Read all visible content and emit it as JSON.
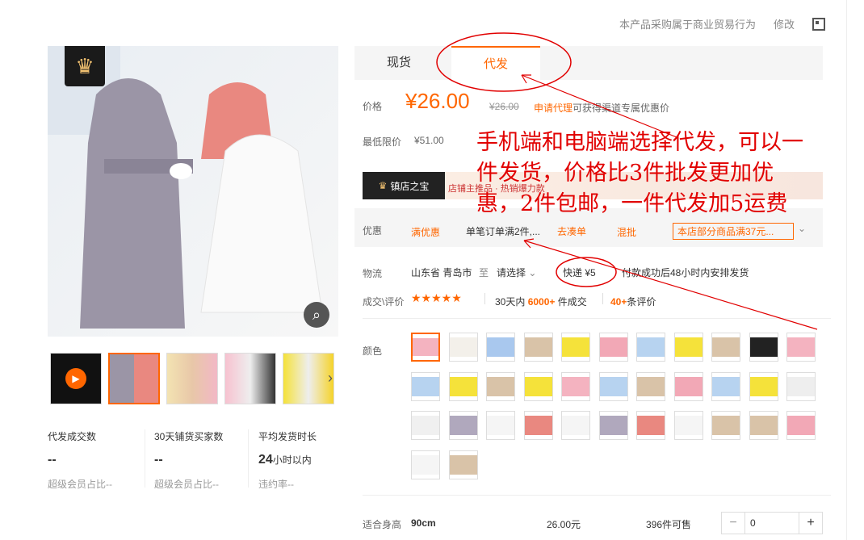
{
  "top": {
    "notice": "本产品采购属于商业贸易行为",
    "edit": "修改",
    "qr_icon": "qr-code-icon"
  },
  "tabs": [
    "现货",
    "代发"
  ],
  "price": {
    "label": "价格",
    "value": "¥26.00",
    "original": "¥26.00",
    "apply_link": "申请代理",
    "apply_text": "可获得渠道专属优惠价"
  },
  "min_price": {
    "label": "最低限价",
    "value": "¥51.00"
  },
  "banner": {
    "badge": "镇店之宝",
    "text": "店铺主推品 · 热销爆力款"
  },
  "promo": {
    "label": "优惠",
    "tag": "满优惠",
    "desc": "单笔订单满2件,...",
    "link": "去凑单",
    "mix": "混批",
    "shop": "本店部分商品满37元..."
  },
  "logistics": {
    "label": "物流",
    "origin": "山东省 青岛市",
    "to": "至",
    "select": "请选择",
    "express": "快递 ¥5",
    "note": "付款成功后48小时内安排发货"
  },
  "review": {
    "label": "成交\\评价",
    "stars": "★★★★★",
    "sales_prefix": "30天内",
    "sales_count": "6000+",
    "sales_suffix": "件成交",
    "review_count": "40+",
    "review_suffix": "条评价"
  },
  "color": {
    "label": "颜色"
  },
  "size_row": {
    "label": "适合身高",
    "size": "90cm",
    "price": "26.00元",
    "stock": "396件可售",
    "qty": "0"
  },
  "stats": [
    {
      "label": "代发成交数",
      "value": "--",
      "sub": "超级会员占比--"
    },
    {
      "label": "30天铺货买家数",
      "value": "--",
      "sub": "超级会员占比--"
    },
    {
      "label": "平均发货时长",
      "value": "24",
      "unit": "小时以内",
      "sub": "违约率--"
    }
  ],
  "annotation": "手机端和电脑端选择代发，可以一件发货，价格比3件批发更加优惠，2件包邮，一件代发加5运费"
}
